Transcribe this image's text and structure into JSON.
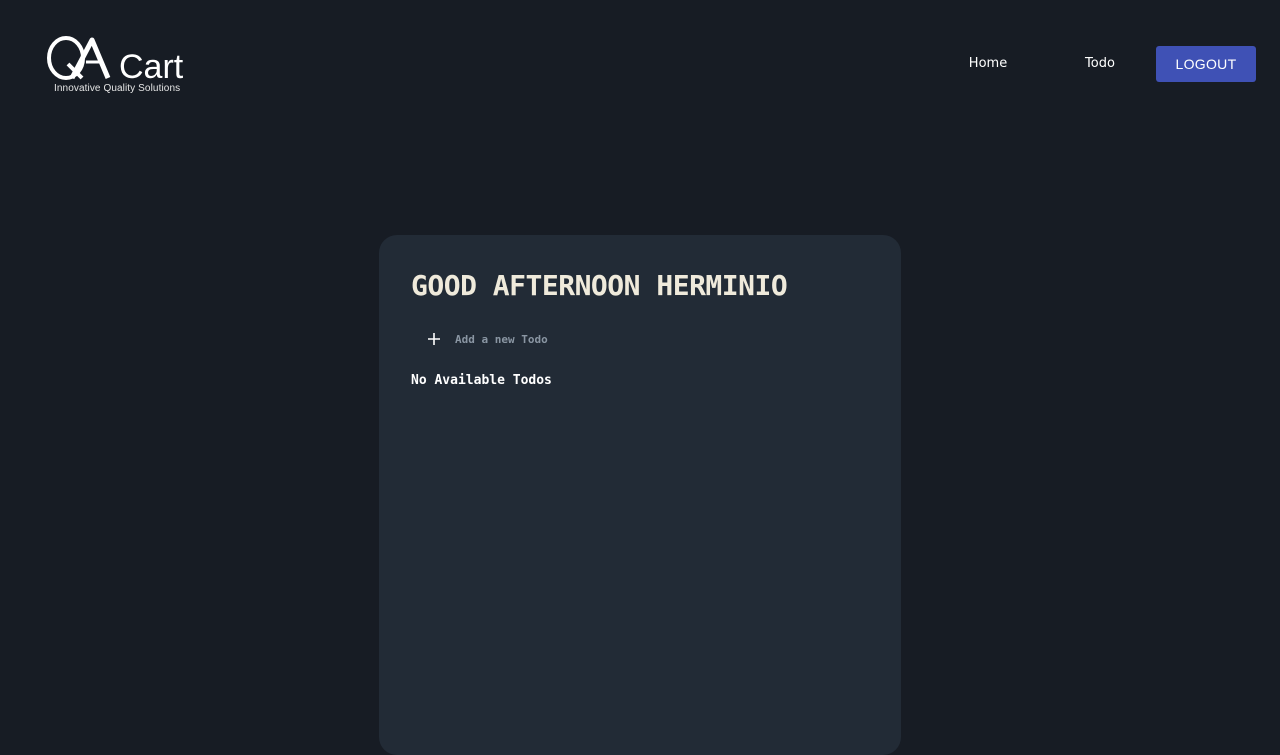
{
  "app": {
    "logo_text": "QACart",
    "logo_tagline": "Innovative Quality Solutions"
  },
  "nav": {
    "items": [
      {
        "label": "Home"
      },
      {
        "label": "Todo"
      }
    ],
    "logout_label": "LOGOUT"
  },
  "main": {
    "greeting": "GOOD AFTERNOON HERMINIO",
    "add_todo": {
      "icon": "plus-icon",
      "placeholder": "Add a new Todo",
      "value": ""
    },
    "empty_message": "No Available Todos"
  },
  "colors": {
    "background": "#171c24",
    "card": "#222b36",
    "accent": "#3f51b5",
    "greeting_text": "#efeadb"
  }
}
